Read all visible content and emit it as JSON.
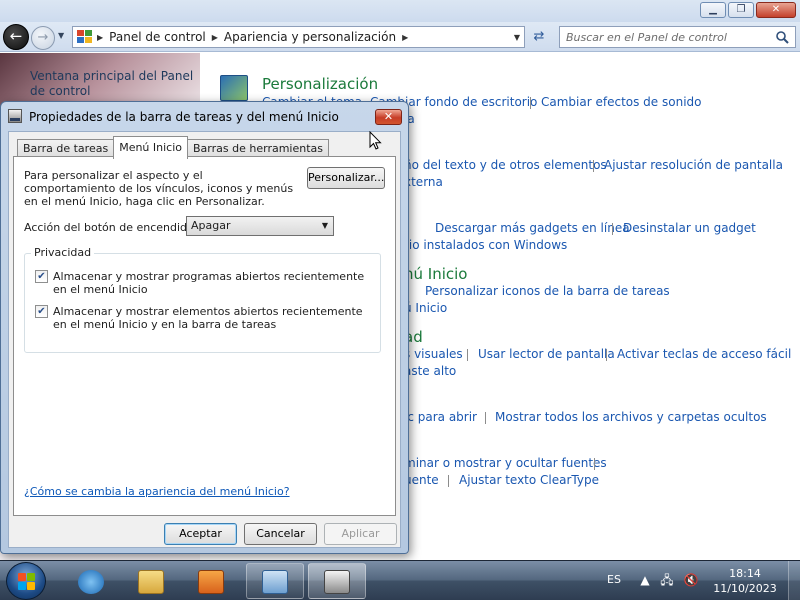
{
  "explorer": {
    "address": {
      "crumbs": [
        "Panel de control",
        "Apariencia y personalización"
      ]
    },
    "search": {
      "placeholder": "Buscar en el Panel de control"
    },
    "sidebar": {
      "home_link": "Ventana principal del Panel de control"
    },
    "content": {
      "rows": [
        {
          "heading": "Personalización",
          "links": [
            "Cambiar el tema",
            "Cambiar fondo de escritorio",
            "Cambiar efectos de sonido"
          ]
        },
        {
          "links": [
            "la"
          ]
        },
        {
          "links": [
            "ño del texto y de otros elementos",
            "Ajustar resolución de pantalla"
          ]
        },
        {
          "links": [
            "xterna"
          ]
        },
        {
          "links": [
            "Descargar más gadgets en línea",
            "Desinstalar un gadget"
          ]
        },
        {
          "links": [
            "rio instalados con Windows"
          ]
        },
        {
          "heading": "nú Inicio"
        },
        {
          "links": [
            "Personalizar iconos de la barra de tareas"
          ]
        },
        {
          "links": [
            "ú Inicio"
          ]
        },
        {
          "heading": "ad"
        },
        {
          "links": [
            "s visuales",
            "Usar lector de pantalla",
            "Activar teclas de acceso fácil"
          ]
        },
        {
          "links": [
            "aste alto"
          ]
        },
        {
          "links": [
            "ic para abrir",
            "Mostrar todos los archivos y carpetas ocultos"
          ]
        },
        {
          "links": [
            "minar o mostrar y ocultar fuentes"
          ]
        },
        {
          "links": [
            "uente",
            "Ajustar texto ClearType"
          ]
        }
      ]
    }
  },
  "dialog": {
    "title": "Propiedades de la barra de tareas y del menú Inicio",
    "tabs": [
      "Barra de tareas",
      "Menú Inicio",
      "Barras de herramientas"
    ],
    "active_tab": "Menú Inicio",
    "description": "Para personalizar el aspecto y el comportamiento de los vínculos, iconos y menús en el menú Inicio, haga clic en Personalizar.",
    "customize_button": "Personalizar...",
    "power_button_label": "Acción del botón de encendido:",
    "power_button_value": "Apagar",
    "privacy_group": "Privacidad",
    "checkboxes": [
      {
        "label": "Almacenar y mostrar programas abiertos recientemente en el menú Inicio",
        "checked": true
      },
      {
        "label": "Almacenar y mostrar elementos abiertos recientemente en el menú Inicio y en la barra de tareas",
        "checked": true
      }
    ],
    "help_link": "¿Cómo se cambia la apariencia del menú Inicio?",
    "buttons": {
      "ok": "Aceptar",
      "cancel": "Cancelar",
      "apply": "Aplicar"
    }
  },
  "taskbar": {
    "language": "ES",
    "time": "18:14",
    "date": "11/10/2023"
  },
  "colors": {
    "link": "#1a57b0",
    "heading": "#1b7a3b",
    "taskbar": "#3e5066"
  }
}
